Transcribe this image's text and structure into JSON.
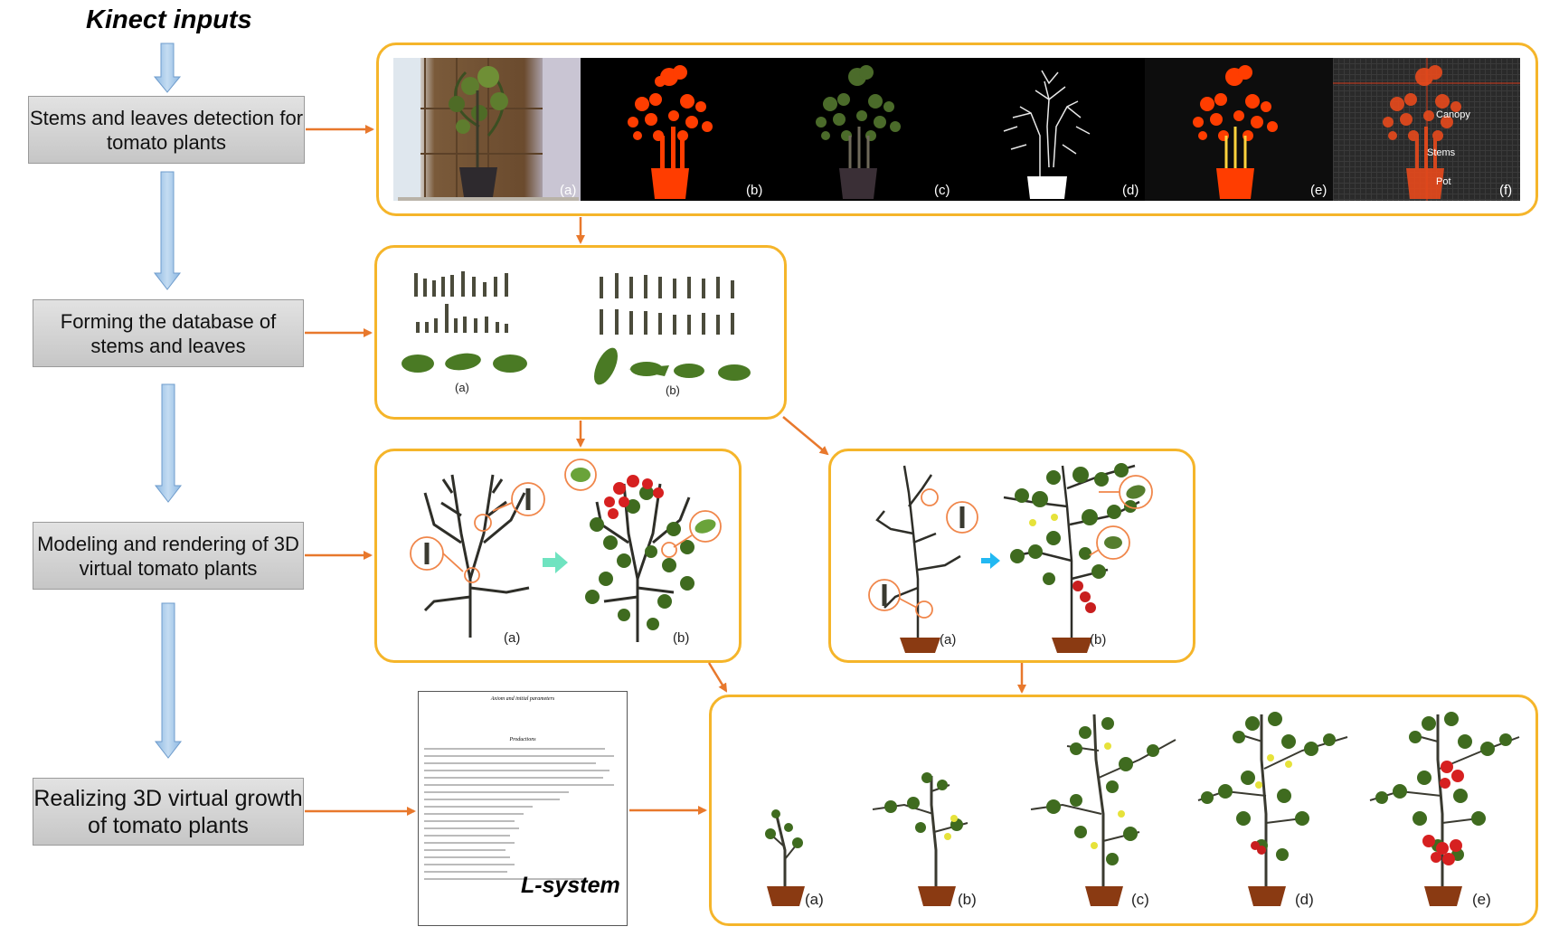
{
  "title": "Kinect inputs",
  "steps": [
    {
      "label": "Stems and leaves detection for tomato plants"
    },
    {
      "label": "Forming the database of stems and leaves"
    },
    {
      "label": "Modeling and rendering of 3D virtual tomato plants"
    },
    {
      "label": "Realizing 3D virtual growth of tomato plants"
    }
  ],
  "detection_panel": {
    "labels": [
      "(a)",
      "(b)",
      "(c)",
      "(d)",
      "(e)",
      "(f)"
    ],
    "annotations": [
      "Canopy",
      "Stems",
      "Pot"
    ]
  },
  "database_panel": {
    "labels": [
      "(a)",
      "(b)"
    ]
  },
  "modeling_panel_1": {
    "labels": [
      "(a)",
      "(b)"
    ]
  },
  "modeling_panel_2": {
    "labels": [
      "(a)",
      "(b)"
    ]
  },
  "growth_panel": {
    "labels": [
      "(a)",
      "(b)",
      "(c)",
      "(d)",
      "(e)"
    ]
  },
  "lsystem": {
    "caption": "L-system",
    "doc_title": "Axiom and initial parameters",
    "doc_section": "Productions"
  },
  "colors": {
    "panel_border": "#f5b52a",
    "arrow_orange": "#e8782c",
    "arrow_blue": "#9dc3e6",
    "plant_red": "#ff3d00",
    "leaf_green": "#3f6b1f",
    "stem": "#3a3a3a",
    "pot": "#8a3a12"
  }
}
